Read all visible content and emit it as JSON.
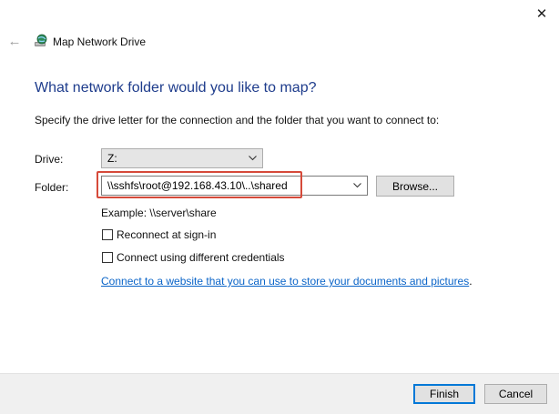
{
  "window": {
    "title": "Map Network Drive",
    "close_glyph": "✕",
    "back_glyph": "←",
    "icons": [
      "close-icon",
      "back-arrow-icon",
      "network-drive-icon"
    ]
  },
  "main": {
    "heading": "What network folder would you like to map?",
    "instructions": "Specify the drive letter for the connection and the folder that you want to connect to:"
  },
  "form": {
    "drive_label": "Drive:",
    "drive_value": "Z:",
    "folder_label": "Folder:",
    "folder_value": "\\\\sshfs\\root@192.168.43.10\\..\\shared",
    "browse_label": "Browse...",
    "example": "Example: \\\\server\\share",
    "reconnect_label": "Reconnect at sign-in",
    "reconnect_checked": false,
    "credentials_label": "Connect using different credentials",
    "credentials_checked": false,
    "link_text": "Connect to a website that you can use to store your documents and pictures",
    "link_suffix": "."
  },
  "footer": {
    "finish_label": "Finish",
    "cancel_label": "Cancel"
  },
  "colors": {
    "heading": "#1e3c8c",
    "link": "#0a64c8",
    "highlight": "#d64a3a",
    "accent": "#0078d7"
  }
}
